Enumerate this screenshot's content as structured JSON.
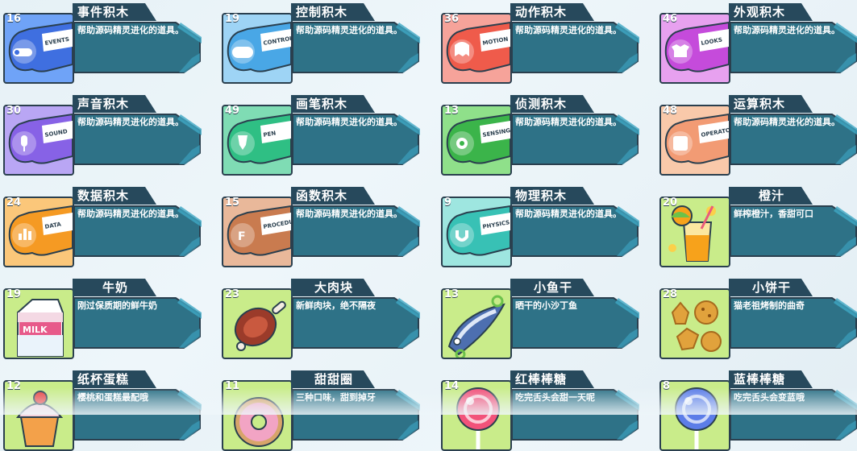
{
  "colors": {
    "panel": "#2e7287",
    "panel_border": "#2a3f4e",
    "panel_light": "#3ea7c4",
    "tab_dark": "#27495c",
    "text": "#ffffff"
  },
  "items": [
    {
      "count": "16",
      "title": "事件积木",
      "desc": "帮助源码精灵进化的道具。",
      "icon": "events-block-icon",
      "bg": "#6fa3f7",
      "main": "#3f6fe0",
      "label": "EVENTS"
    },
    {
      "count": "19",
      "title": "控制积木",
      "desc": "帮助源码精灵进化的道具。",
      "icon": "control-block-icon",
      "bg": "#9ed4f5",
      "main": "#49a7e6",
      "label": "CONTROL"
    },
    {
      "count": "36",
      "title": "动作积木",
      "desc": "帮助源码精灵进化的道具。",
      "icon": "motion-block-icon",
      "bg": "#f6a39a",
      "main": "#ef5b4b",
      "label": "MOTION"
    },
    {
      "count": "46",
      "title": "外观积木",
      "desc": "帮助源码精灵进化的道具。",
      "icon": "looks-block-icon",
      "bg": "#e7a1ef",
      "main": "#c54bdb",
      "label": "LOOKS"
    },
    {
      "count": "30",
      "title": "声音积木",
      "desc": "帮助源码精灵进化的道具。",
      "icon": "sound-block-icon",
      "bg": "#b9a6f4",
      "main": "#8762e6",
      "label": "SOUND"
    },
    {
      "count": "49",
      "title": "画笔积木",
      "desc": "帮助源码精灵进化的道具。",
      "icon": "pen-block-icon",
      "bg": "#7fdcb4",
      "main": "#2fbf84",
      "label": "PEN"
    },
    {
      "count": "13",
      "title": "侦测积木",
      "desc": "帮助源码精灵进化的道具。",
      "icon": "sensing-block-icon",
      "bg": "#8fe08a",
      "main": "#3bb44a",
      "label": "SENSING"
    },
    {
      "count": "48",
      "title": "运算积木",
      "desc": "帮助源码精灵进化的道具。",
      "icon": "operators-block-icon",
      "bg": "#f9c9aa",
      "main": "#f29b74",
      "label": "OPERATORS"
    },
    {
      "count": "24",
      "title": "数据积木",
      "desc": "帮助源码精灵进化的道具。",
      "icon": "data-block-icon",
      "bg": "#fbc77a",
      "main": "#f59a23",
      "label": "DATA"
    },
    {
      "count": "15",
      "title": "函数积木",
      "desc": "帮助源码精灵进化的道具。",
      "icon": "procedures-block-icon",
      "bg": "#e9b89a",
      "main": "#c97b4f",
      "label": "PROCEDURES"
    },
    {
      "count": "9",
      "title": "物理积木",
      "desc": "帮助源码精灵进化的道具。",
      "icon": "physics-block-icon",
      "bg": "#9ee6e0",
      "main": "#38c1b5",
      "label": "PHYSICS"
    },
    {
      "count": "20",
      "title": "橙汁",
      "desc": "鲜榨橙汁，香甜可口",
      "icon": "orange-juice-icon",
      "bg": "#c9ec8a",
      "main": "#f7a21b",
      "label": ""
    },
    {
      "count": "19",
      "title": "牛奶",
      "desc": "刚过保质期的鲜牛奶",
      "icon": "milk-carton-icon",
      "bg": "#c9ec8a",
      "main": "#e75a8a",
      "label": "MILK"
    },
    {
      "count": "23",
      "title": "大肉块",
      "desc": "新鲜肉块，绝不隔夜",
      "icon": "meat-chunk-icon",
      "bg": "#c9ec8a",
      "main": "#9b3b2a",
      "label": ""
    },
    {
      "count": "13",
      "title": "小鱼干",
      "desc": "晒干的小沙丁鱼",
      "icon": "dried-fish-icon",
      "bg": "#c9ec8a",
      "main": "#4d6fb0",
      "label": ""
    },
    {
      "count": "28",
      "title": "小饼干",
      "desc": "猫老祖烤制的曲奇",
      "icon": "cookies-icon",
      "bg": "#c9ec8a",
      "main": "#e1a23c",
      "label": ""
    },
    {
      "count": "12",
      "title": "纸杯蛋糕",
      "desc": "樱桃和蛋糕最配哦",
      "icon": "cupcake-icon",
      "bg": "#c9ec8a",
      "main": "#e8403f",
      "label": ""
    },
    {
      "count": "11",
      "title": "甜甜圈",
      "desc": "三种口味，甜到掉牙",
      "icon": "donut-icon",
      "bg": "#c9ec8a",
      "main": "#f2a4c4",
      "label": ""
    },
    {
      "count": "14",
      "title": "红棒棒糖",
      "desc": "吃完舌头会甜一天呢",
      "icon": "red-lollipop-icon",
      "bg": "#c9ec8a",
      "main": "#f2527a",
      "label": ""
    },
    {
      "count": "8",
      "title": "蓝棒棒糖",
      "desc": "吃完舌头会变蓝哦",
      "icon": "blue-lollipop-icon",
      "bg": "#c9ec8a",
      "main": "#5c7de8",
      "label": ""
    }
  ]
}
